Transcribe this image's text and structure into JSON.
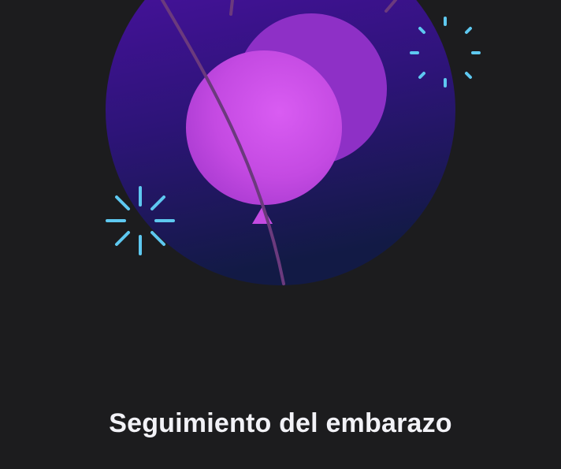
{
  "onboarding": {
    "title": "Seguimiento del embarazo"
  },
  "colors": {
    "background": "#1c1c1e",
    "globe_top": "#4a12a0",
    "globe_bottom": "#15194a",
    "balloon_back": "#8b2fc4",
    "balloon_front": "#c84fe6",
    "sparkle": "#5ec8f0",
    "string": "#6e3b7a"
  },
  "icons": {
    "hero": "balloon-celebration-illustration",
    "sparkles": [
      "sparkle-burst-icon",
      "sparkle-burst-icon"
    ]
  }
}
